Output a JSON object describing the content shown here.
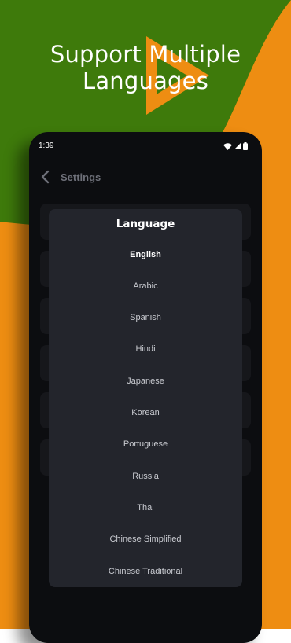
{
  "headline": {
    "line1": "Support Multiple",
    "line2": "Languages"
  },
  "colors": {
    "green": "#3e7a0b",
    "orange": "#ee8d12",
    "phone": "#0c0d10",
    "dialog": "#23252c"
  },
  "status_bar": {
    "time": "1:39",
    "icons": [
      "wifi-icon",
      "signal-icon",
      "battery-icon"
    ]
  },
  "app_bar": {
    "title": "Settings",
    "back_icon": "chevron-left-icon"
  },
  "dialog": {
    "title": "Language",
    "selected": "English",
    "options": [
      "English",
      "Arabic",
      "Spanish",
      "Hindi",
      "Japanese",
      "Korean",
      "Portuguese",
      "Russia",
      "Thai",
      "Chinese Simplified",
      "Chinese Traditional"
    ]
  }
}
